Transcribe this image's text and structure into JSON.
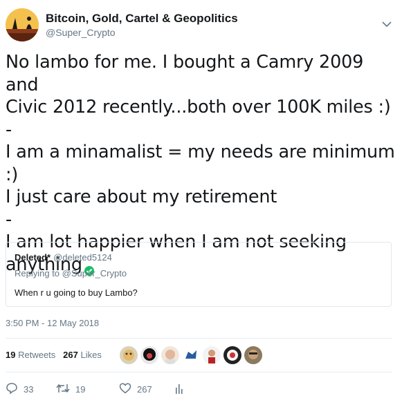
{
  "author": {
    "display_name": "Bitcoin, Gold, Cartel & Geopolitics",
    "handle": "@Super_Crypto"
  },
  "tweet": {
    "text": "No lambo for me. I bought a Camry 2009 and\nCivic 2012 recently...both over 100K miles :)\n-\nI am a minamalist = my needs are minimum :)\nI just care about my retirement\n-\nI am lot happier when I am not seeking\nanything"
  },
  "quoted_tweet": {
    "display_name": "Deleted*",
    "handle": "@deleted5124",
    "replying_to": "Replying to @Super_Crypto",
    "text": "When r u going to buy Lambo?"
  },
  "timestamp": "3:50 PM - 12 May 2018",
  "stats": {
    "retweets_count": "19",
    "retweets_label": "Retweets",
    "likes_count": "267",
    "likes_label": "Likes"
  },
  "actions": {
    "reply_count": "33",
    "retweet_count": "19",
    "like_count": "267"
  },
  "colors": {
    "text": "#14171a",
    "secondary": "#657786",
    "border": "#e1e8ed",
    "check": "#17bf63"
  }
}
